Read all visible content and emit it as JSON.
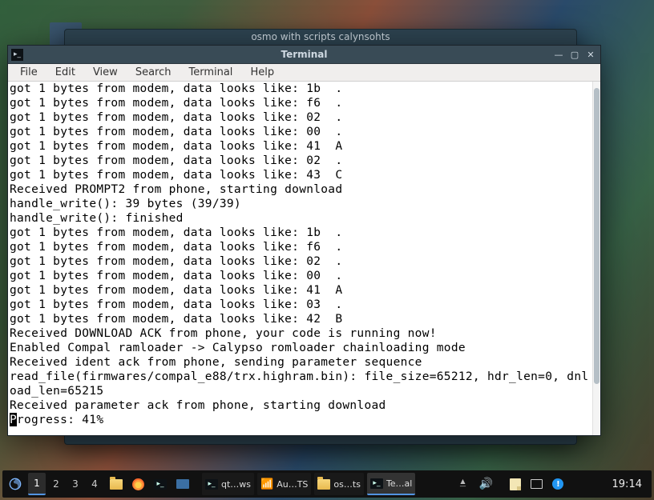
{
  "bg_window_title": "osmo with scripts calynsohts",
  "window": {
    "title": "Terminal",
    "menu": [
      "File",
      "Edit",
      "View",
      "Search",
      "Terminal",
      "Help"
    ]
  },
  "terminal_lines": [
    "got 1 bytes from modem, data looks like: 1b  .",
    "got 1 bytes from modem, data looks like: f6  .",
    "got 1 bytes from modem, data looks like: 02  .",
    "got 1 bytes from modem, data looks like: 00  .",
    "got 1 bytes from modem, data looks like: 41  A",
    "got 1 bytes from modem, data looks like: 02  .",
    "got 1 bytes from modem, data looks like: 43  C",
    "Received PROMPT2 from phone, starting download",
    "handle_write(): 39 bytes (39/39)",
    "handle_write(): finished",
    "got 1 bytes from modem, data looks like: 1b  .",
    "got 1 bytes from modem, data looks like: f6  .",
    "got 1 bytes from modem, data looks like: 02  .",
    "got 1 bytes from modem, data looks like: 00  .",
    "got 1 bytes from modem, data looks like: 41  A",
    "got 1 bytes from modem, data looks like: 03  .",
    "got 1 bytes from modem, data looks like: 42  B",
    "Received DOWNLOAD ACK from phone, your code is running now!",
    "Enabled Compal ramloader -> Calypso romloader chainloading mode",
    "Received ident ack from phone, sending parameter sequence",
    "read_file(firmwares/compal_e88/trx.highram.bin): file_size=65212, hdr_len=0, dnl",
    "oad_len=65215",
    "Received parameter ack from phone, starting download"
  ],
  "progress_prefix": "P",
  "progress_text": "rogress: 41%",
  "taskbar": {
    "workspaces": [
      "1",
      "2",
      "3",
      "4"
    ],
    "active_ws": "1",
    "tasks": [
      {
        "id": "qt",
        "label": "qt…ws",
        "icon": "term"
      },
      {
        "id": "au",
        "label": "Au…TS",
        "icon": "wifi"
      },
      {
        "id": "os",
        "label": "os…ts",
        "icon": "folder"
      },
      {
        "id": "te",
        "label": "Te…al",
        "icon": "term",
        "active": true
      }
    ],
    "clock": "19:14"
  }
}
